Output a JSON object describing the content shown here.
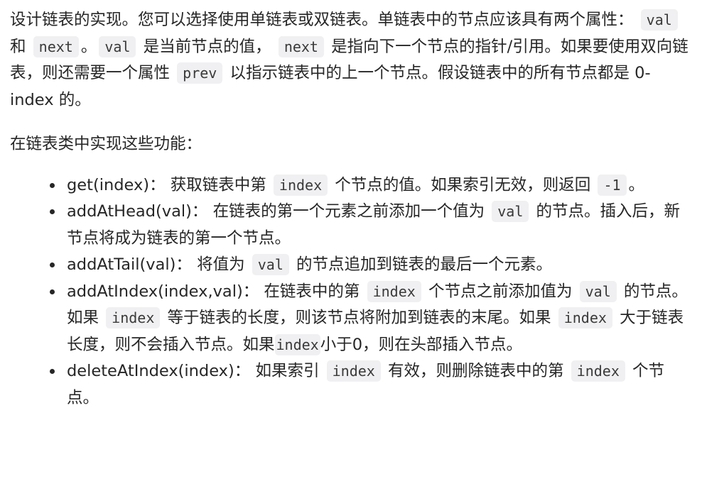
{
  "intro": {
    "t1": "设计链表的实现。您可以选择使用单链表或双链表。单链表中的节点应该具有两个属性：",
    "c1": "val",
    "t2": "和",
    "c2": "next",
    "t3": "。",
    "c3": "val",
    "t4": "是当前节点的值，",
    "c4": "next",
    "t5": "是指向下一个节点的指针/引用。如果要使用双向链表，则还需要一个属性",
    "c5": "prev",
    "t6": "以指示链表中的上一个节点。假设链表中的所有节点都是 0-index 的。"
  },
  "lead": "在链表类中实现这些功能：",
  "methods": [
    {
      "name": "get(index)",
      "sep": "：",
      "t1": "获取链表中第",
      "c1": "index",
      "t2": "个节点的值。如果索引无效，则返回",
      "c2": "-1",
      "t3": "。"
    },
    {
      "name": "addAtHead(val)",
      "sep": "：",
      "t1": "在链表的第一个元素之前添加一个值为",
      "c1": "val",
      "t2": "的节点。插入后，新节点将成为链表的第一个节点。"
    },
    {
      "name": "addAtTail(val)",
      "sep": "：",
      "t1": "将值为",
      "c1": "val",
      "t2": "的节点追加到链表的最后一个元素。"
    },
    {
      "name": "addAtIndex(index,val)",
      "sep": "：",
      "t1": "在链表中的第",
      "c1": "index",
      "t2": "个节点之前添加值为",
      "c2": "val",
      "t3": "的节点。如果",
      "c3": "index",
      "t4": "等于链表的长度，则该节点将附加到链表的末尾。如果",
      "c4": "index",
      "t5": "大于链表长度，则不会插入节点。如果",
      "c5": "index",
      "t6": "小于0，则在头部插入节点。"
    },
    {
      "name": "deleteAtIndex(index)",
      "sep": "：",
      "t1": "如果索引",
      "c1": "index",
      "t2": "有效，则删除链表中的第",
      "c2": "index",
      "t3": "个节点。"
    }
  ]
}
